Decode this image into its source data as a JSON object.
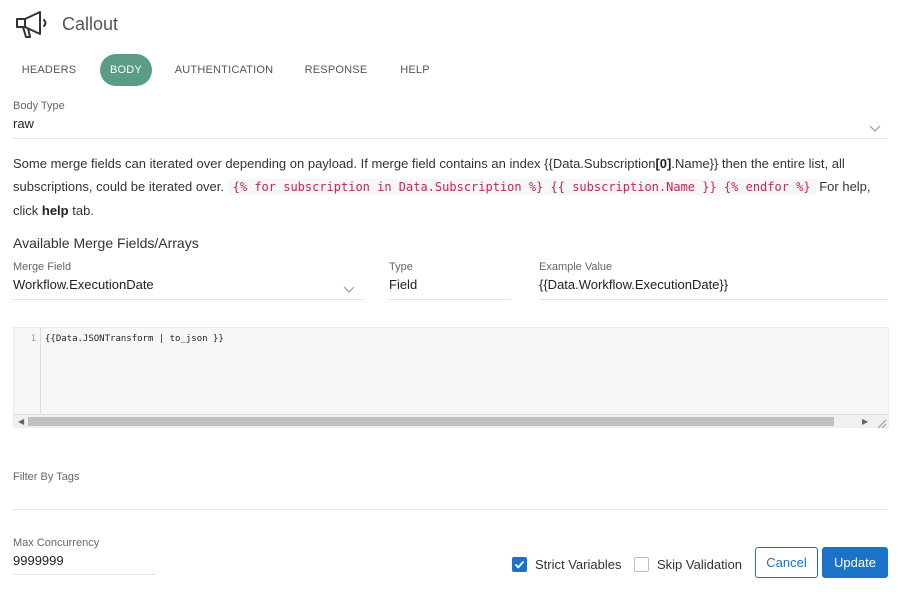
{
  "header": {
    "title": "Callout"
  },
  "tabs": [
    {
      "label": "HEADERS"
    },
    {
      "label": "BODY",
      "active": true
    },
    {
      "label": "AUTHENTICATION"
    },
    {
      "label": "RESPONSE"
    },
    {
      "label": "HELP"
    }
  ],
  "body_type": {
    "label": "Body Type",
    "value": "raw"
  },
  "info": {
    "part1": "Some merge fields can iterated over depending on payload. If merge field contains an index {{Data.Subscription",
    "bold_index": "[0]",
    "part2": ".Name}} then the entire list, all subscriptions, could be iterated over.",
    "code": "{% for subscription in Data.Subscription %} {{ subscription.Name }} {% endfor %}",
    "part3": " For help, click ",
    "help_word": "help",
    "part4": " tab."
  },
  "merge_section": {
    "title": "Available Merge Fields/Arrays",
    "merge_field_label": "Merge Field",
    "merge_field_value": "Workflow.ExecutionDate",
    "type_label": "Type",
    "type_value": "Field",
    "example_label": "Example Value",
    "example_value": "{{Data.Workflow.ExecutionDate}}"
  },
  "editor": {
    "line_number": "1",
    "code": "{{Data.JSONTransform | to_json }}"
  },
  "filter": {
    "label": "Filter By Tags",
    "value": ""
  },
  "concurrency": {
    "label": "Max Concurrency",
    "value": "9999999"
  },
  "options": {
    "strict_label": "Strict Variables",
    "strict_checked": true,
    "skip_label": "Skip Validation",
    "skip_checked": false
  },
  "buttons": {
    "cancel": "Cancel",
    "update": "Update"
  },
  "colors": {
    "accent": "#1a73c8",
    "tab_active": "#5a9c86",
    "code_inline": "#c7254e"
  }
}
